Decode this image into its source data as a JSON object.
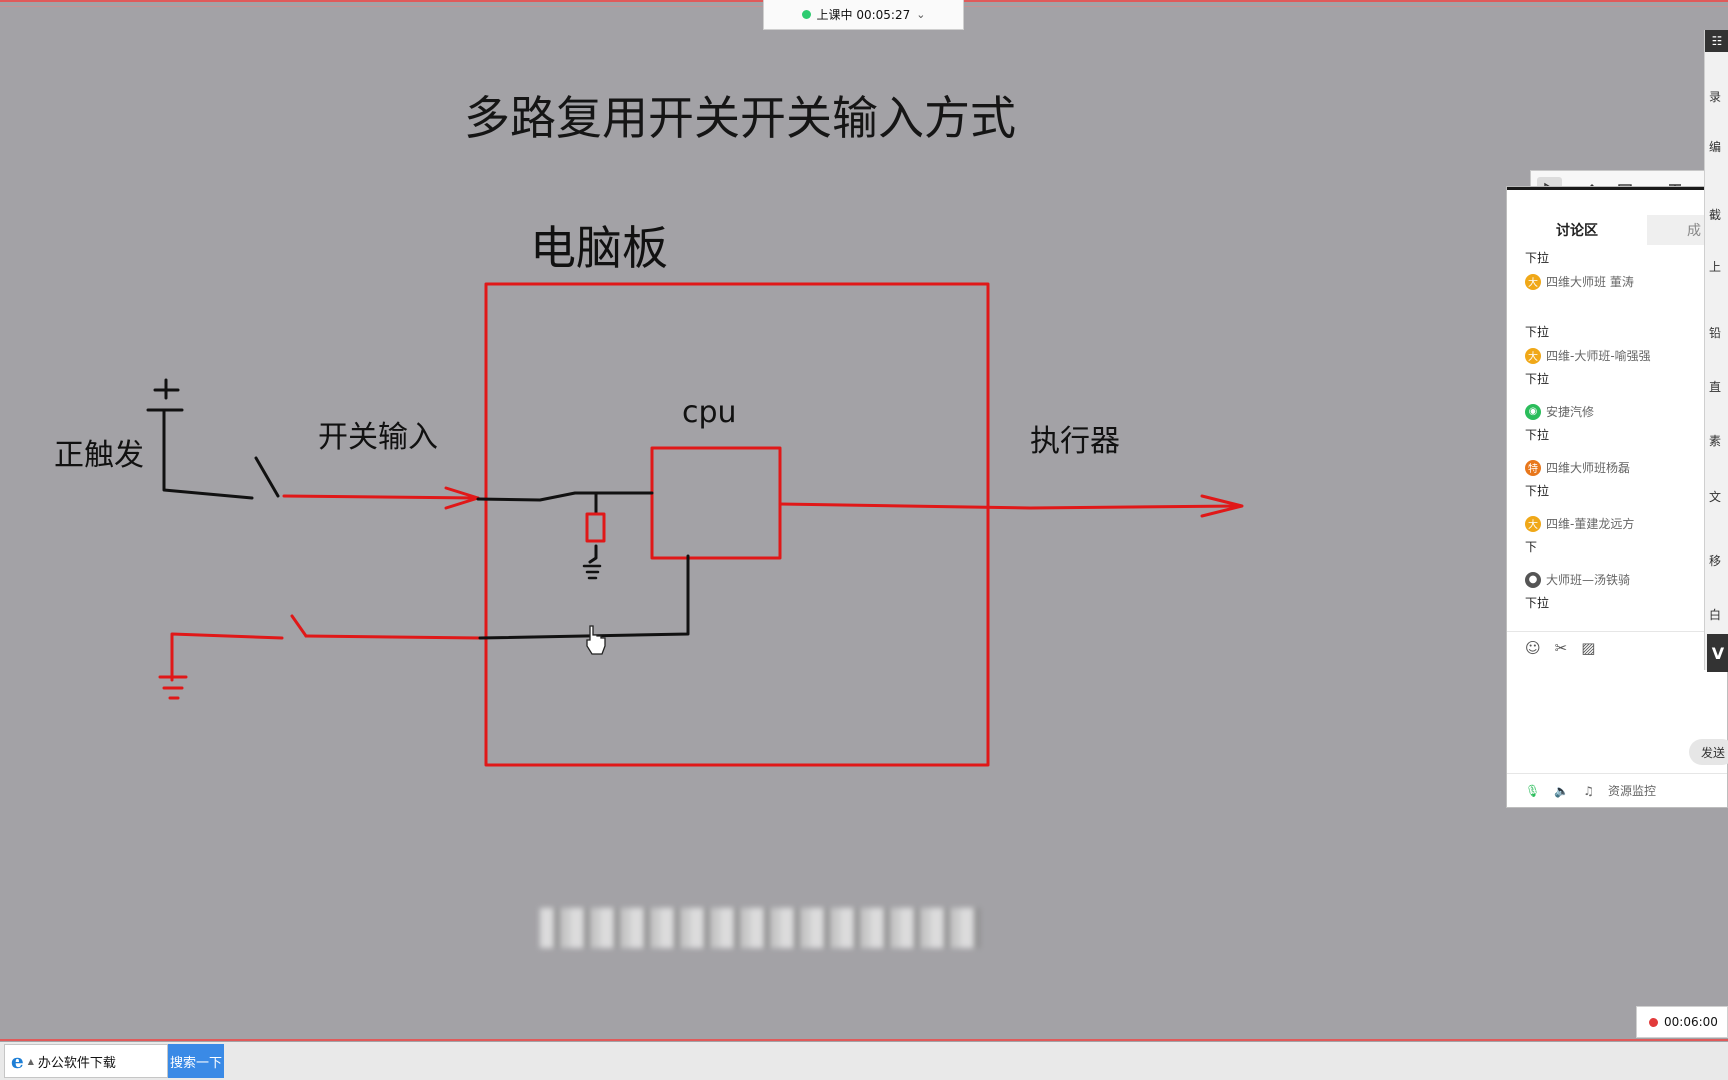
{
  "status_bar": {
    "status": "上课中 00:05:27",
    "dot_color": "#2ecc71",
    "dropdown_icon": "chevron-down-icon"
  },
  "slide": {
    "title": "多路复用开关开关输入方式",
    "board_label": "电脑板",
    "cpu_label": "cpu",
    "positive_trigger": "正触发",
    "switch_input": "开关输入",
    "actuator": "执行器",
    "accent_color": "#e01818"
  },
  "draw_toolbar": {
    "tools": [
      "select-icon",
      "pen-icon",
      "rectangle-icon",
      "text-icon",
      "eraser-icon"
    ]
  },
  "chat": {
    "tab_active": "讨论区",
    "tab_other": "成",
    "first_text": "下拉",
    "messages": [
      {
        "sender": "四维大师班 董涛",
        "avatar": "大",
        "avatar_color": "#f0a818",
        "text": "下拉"
      },
      {
        "sender": "四维-大师班-喻强强",
        "avatar": "大",
        "avatar_color": "#f0a818",
        "text": "下拉"
      },
      {
        "sender": "安捷汽修",
        "avatar": "",
        "avatar_color": "#2bbd5b",
        "text": "下拉"
      },
      {
        "sender": "四维大师班杨磊",
        "avatar": "特",
        "avatar_color": "#e8771c",
        "text": "下拉"
      },
      {
        "sender": "四维-董建龙远方",
        "avatar": "大",
        "avatar_color": "#f0a818",
        "text": "下"
      },
      {
        "sender": "大师班—汤铁骑",
        "avatar": "",
        "avatar_color": "#555555",
        "text": "下拉"
      }
    ],
    "send_label": "发送",
    "resource_monitor": "资源监控"
  },
  "right_sidebar": {
    "items": [
      "录",
      "编",
      "截",
      "上",
      "铅",
      "直",
      "素",
      "文",
      "移",
      "白"
    ]
  },
  "recording": {
    "timer": "00:06:00",
    "dot_color": "#e23b3b"
  },
  "browser_search": {
    "query": "办公软件下载",
    "button": "搜索一下"
  }
}
